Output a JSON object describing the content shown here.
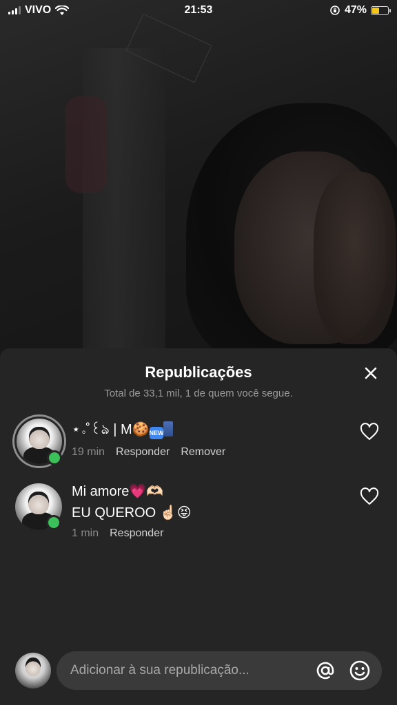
{
  "status_bar": {
    "carrier": "VIVO",
    "time": "21:53",
    "battery_percent": "47%",
    "battery_level": 0.47
  },
  "sheet": {
    "title": "Republicações",
    "subtitle": "Total de 33,1 mil, 1 de quem você segue."
  },
  "comments": [
    {
      "name": "⋆｡˚꒰ঌ | M🍪",
      "time": "19 min",
      "actions": [
        "Responder",
        "Remover"
      ]
    },
    {
      "name": "Mi amore💗🫶🏻",
      "text": "EU QUEROO ☝🏻😝",
      "time": "1 min",
      "actions": [
        "Responder"
      ]
    }
  ],
  "new_badge": "NEW",
  "input": {
    "placeholder": "Adicionar à sua republicação..."
  },
  "colors": {
    "sheet_bg": "#252525",
    "online_dot": "#3cc05a",
    "field_bg": "#3a3a3a"
  }
}
